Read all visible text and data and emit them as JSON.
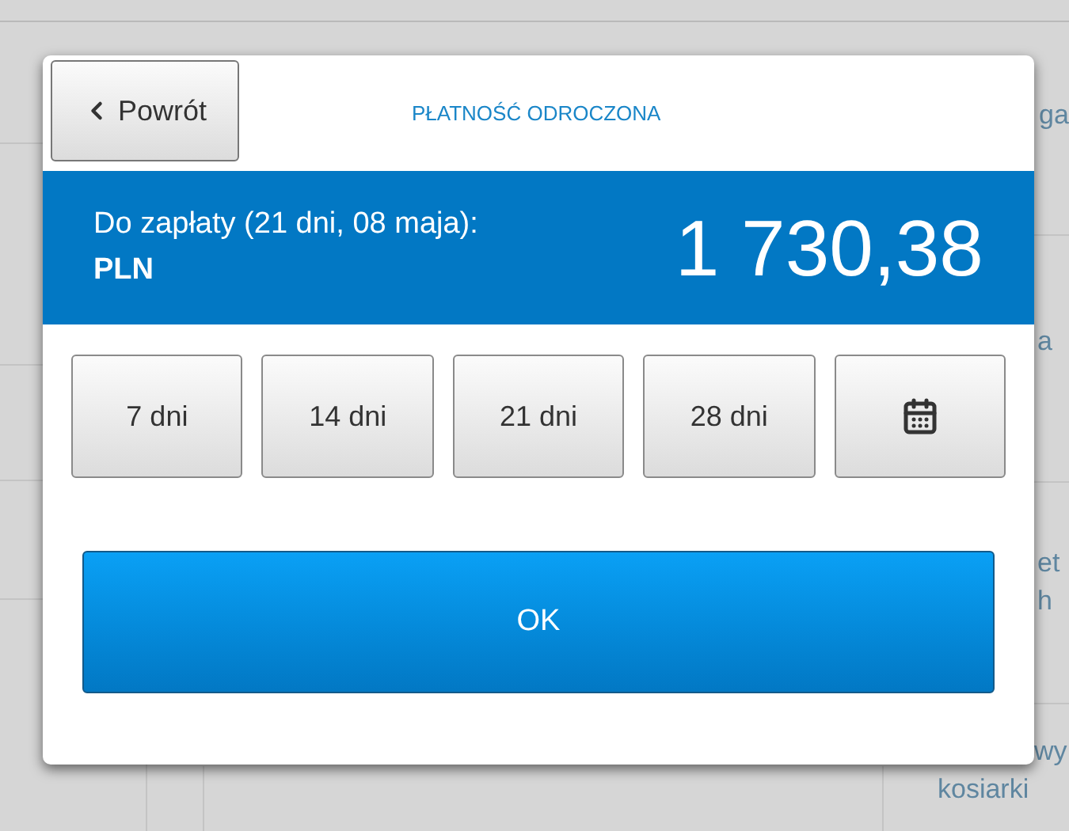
{
  "background": {
    "side_fragments": [
      "ga",
      "a",
      "et",
      "h",
      "wy",
      "kosiarki"
    ]
  },
  "dialog": {
    "back_button": "Powrót",
    "title": "PŁATNOŚĆ ODROCZONA",
    "due_label": "Do zapłaty (21 dni, 08 maja):",
    "currency": "PLN",
    "amount": "1 730,38",
    "term_buttons": [
      {
        "kind": "text",
        "label": "7 dni"
      },
      {
        "kind": "text",
        "label": "14 dni"
      },
      {
        "kind": "text",
        "label": "21 dni"
      },
      {
        "kind": "text",
        "label": "28 dni"
      },
      {
        "kind": "calendar"
      }
    ],
    "ok_button": "OK"
  }
}
